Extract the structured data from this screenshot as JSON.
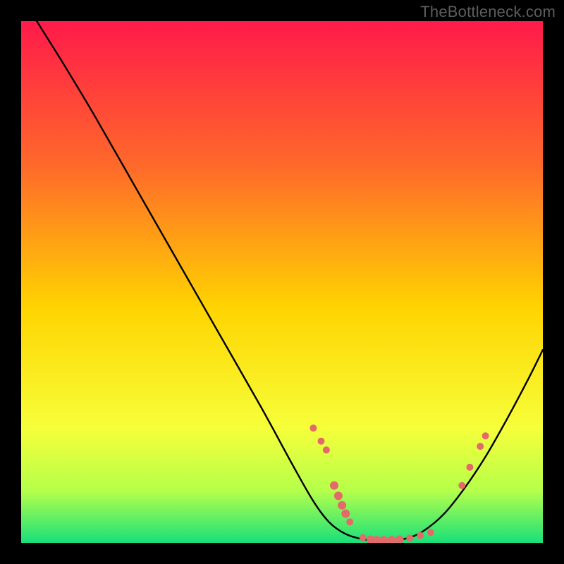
{
  "watermark": "TheBottleneck.com",
  "colors": {
    "bg": "#000000",
    "grad_top": "#ff1a4a",
    "grad_mid1": "#ff6a2a",
    "grad_mid2": "#ffd400",
    "grad_low": "#f6ff3a",
    "grad_green1": "#b6ff4a",
    "grad_green2": "#18e07a",
    "curve": "#000000",
    "marker_fill": "#e46a6a",
    "marker_stroke": "#c84f4f"
  },
  "chart_data": {
    "type": "line",
    "title": "",
    "xlabel": "",
    "ylabel": "",
    "xlim": [
      0,
      100
    ],
    "ylim": [
      0,
      100
    ],
    "curve": {
      "x": [
        0,
        3,
        8,
        14,
        22,
        30,
        38,
        46,
        52,
        56,
        59,
        62,
        65,
        68,
        71,
        74,
        77,
        81,
        85,
        89,
        93,
        97,
        100
      ],
      "y": [
        105,
        100,
        92,
        82,
        68,
        54,
        40,
        26,
        15,
        8,
        4,
        1.8,
        0.8,
        0.4,
        0.4,
        0.9,
        2.2,
        5.5,
        10.5,
        16.5,
        23.5,
        31,
        37
      ]
    },
    "markers": [
      {
        "x": 56.0,
        "y": 22.0,
        "r": 5
      },
      {
        "x": 57.5,
        "y": 19.5,
        "r": 5
      },
      {
        "x": 58.5,
        "y": 17.8,
        "r": 5
      },
      {
        "x": 60.0,
        "y": 11.0,
        "r": 6
      },
      {
        "x": 60.8,
        "y": 9.0,
        "r": 6
      },
      {
        "x": 61.5,
        "y": 7.2,
        "r": 6
      },
      {
        "x": 62.2,
        "y": 5.6,
        "r": 6
      },
      {
        "x": 63.0,
        "y": 4.0,
        "r": 5
      },
      {
        "x": 65.5,
        "y": 1.0,
        "r": 5
      },
      {
        "x": 67.0,
        "y": 0.6,
        "r": 6
      },
      {
        "x": 68.2,
        "y": 0.5,
        "r": 6
      },
      {
        "x": 69.5,
        "y": 0.5,
        "r": 6
      },
      {
        "x": 71.0,
        "y": 0.5,
        "r": 6
      },
      {
        "x": 72.5,
        "y": 0.6,
        "r": 6
      },
      {
        "x": 74.5,
        "y": 0.9,
        "r": 5
      },
      {
        "x": 76.5,
        "y": 1.4,
        "r": 5
      },
      {
        "x": 78.5,
        "y": 2.0,
        "r": 5
      },
      {
        "x": 84.5,
        "y": 11.0,
        "r": 5
      },
      {
        "x": 86.0,
        "y": 14.5,
        "r": 5
      },
      {
        "x": 88.0,
        "y": 18.5,
        "r": 5
      },
      {
        "x": 89.0,
        "y": 20.5,
        "r": 5
      }
    ]
  }
}
